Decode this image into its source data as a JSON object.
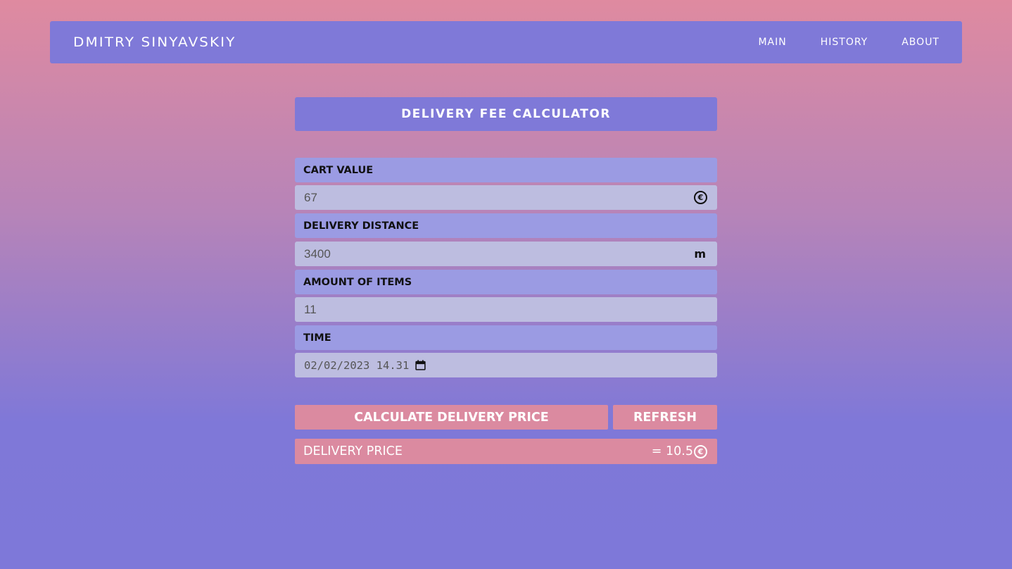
{
  "header": {
    "brand": "DMITRY SINYAVSKIY",
    "nav": [
      "MAIN",
      "HISTORY",
      "ABOUT"
    ]
  },
  "calculator": {
    "title": "DELIVERY FEE CALCULATOR",
    "fields": {
      "cart_value": {
        "label": "CART VALUE",
        "value": "67",
        "unit": "€"
      },
      "distance": {
        "label": "DELIVERY DISTANCE",
        "value": "3400",
        "unit": "m"
      },
      "items": {
        "label": "AMOUNT OF ITEMS",
        "value": "11"
      },
      "time": {
        "label": "TIME",
        "value": "02/02/2023 14.31"
      }
    },
    "buttons": {
      "calculate": "CALCULATE DELIVERY PRICE",
      "refresh": "REFRESH"
    },
    "result": {
      "label": "DELIVERY PRICE",
      "value": "= 10.5",
      "unit": "€"
    }
  },
  "colors": {
    "accent": "#7f79d8",
    "label_bg": "#9b9be3",
    "input_bg": "#bdbde0",
    "button_bg": "#db8aa0"
  }
}
